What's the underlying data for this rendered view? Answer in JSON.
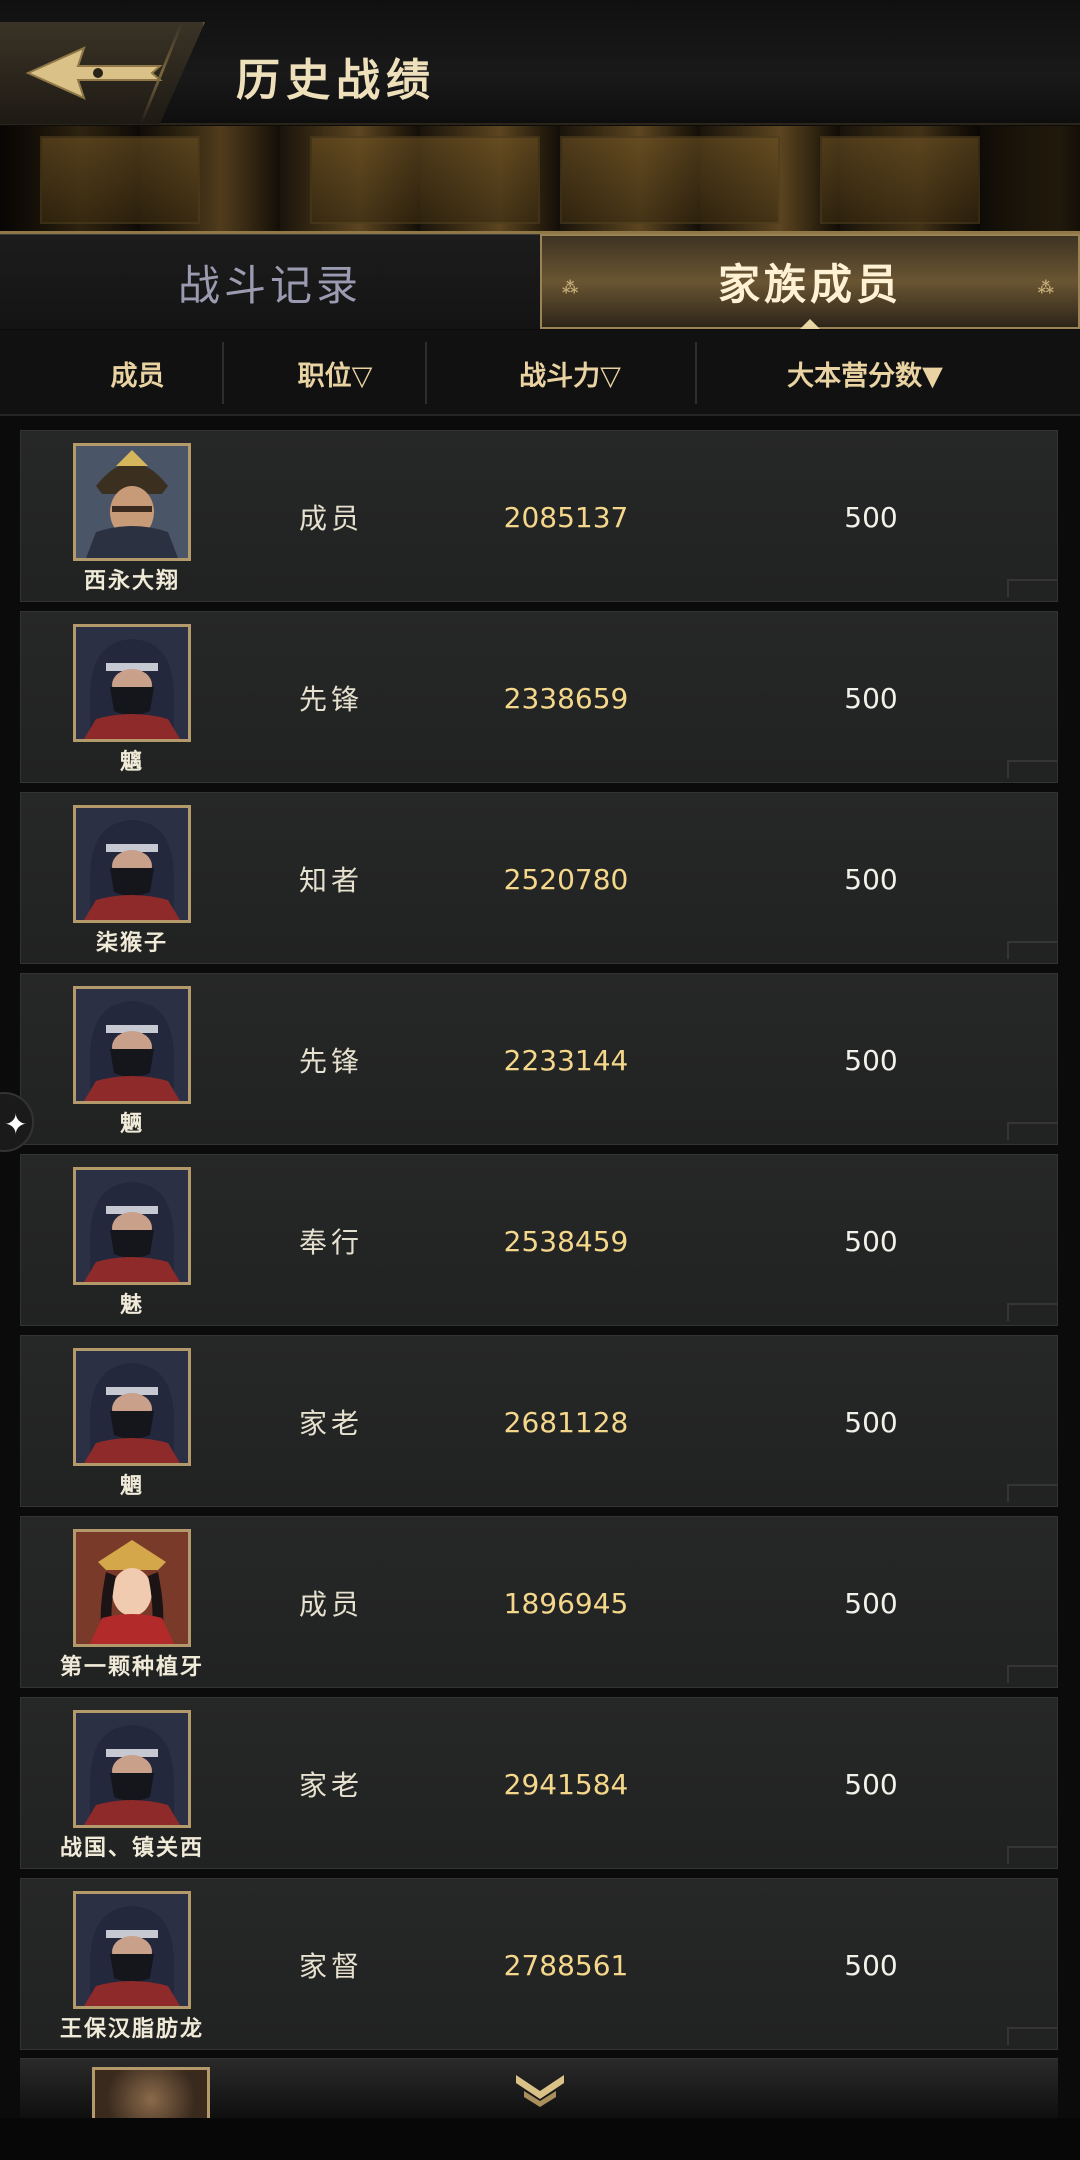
{
  "header": {
    "title": "历史战绩",
    "back_icon": "arrowhead-back-icon"
  },
  "tabs": [
    {
      "label": "战斗记录",
      "active": false
    },
    {
      "label": "家族成员",
      "active": true
    }
  ],
  "columns": {
    "member": "成员",
    "role": "职位▽",
    "power": "战斗力▽",
    "score": "大本营分数▼"
  },
  "rows": [
    {
      "name": "西永大翔",
      "role": "成员",
      "power": "2085137",
      "score": "500",
      "avatar": "samurai"
    },
    {
      "name": "魑",
      "role": "先锋",
      "power": "2338659",
      "score": "500",
      "avatar": "ninja"
    },
    {
      "name": "柒猴子",
      "role": "知者",
      "power": "2520780",
      "score": "500",
      "avatar": "ninja"
    },
    {
      "name": "魉",
      "role": "先锋",
      "power": "2233144",
      "score": "500",
      "avatar": "ninja"
    },
    {
      "name": "魅",
      "role": "奉行",
      "power": "2538459",
      "score": "500",
      "avatar": "ninja"
    },
    {
      "name": "魍",
      "role": "家老",
      "power": "2681128",
      "score": "500",
      "avatar": "ninja"
    },
    {
      "name": "第一颗种植牙",
      "role": "成员",
      "power": "1896945",
      "score": "500",
      "avatar": "princess"
    },
    {
      "name": "战国、镇关西",
      "role": "家老",
      "power": "2941584",
      "score": "500",
      "avatar": "ninja"
    },
    {
      "name": "王保汉脂肪龙",
      "role": "家督",
      "power": "2788561",
      "score": "500",
      "avatar": "ninja"
    }
  ],
  "colors": {
    "accent_gold": "#e9d3a2",
    "power_gold": "#f4d78a"
  }
}
